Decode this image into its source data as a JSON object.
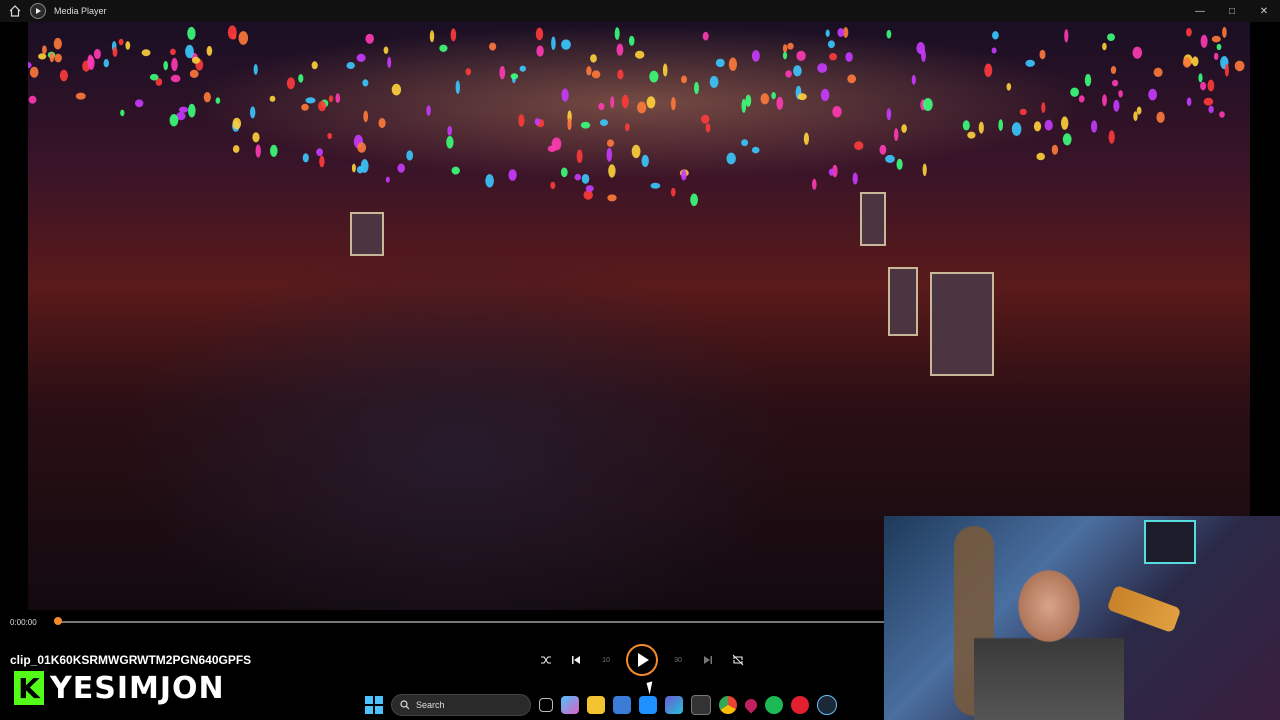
{
  "window": {
    "title": "Media Player",
    "home_icon": "home-icon",
    "app_icon": "media-player-icon",
    "minimize_icon": "minimize-icon",
    "maximize_icon": "maximize-icon",
    "close_icon": "close-icon"
  },
  "player": {
    "current_time": "0:00:00",
    "progress": 0.0,
    "clip_title": "clip_01K60KSRMWGRWTM2PGN640GPFS",
    "controls": {
      "shuffle_icon": "shuffle-icon",
      "previous_icon": "previous-icon",
      "rewind_label": "10",
      "play_icon": "play-icon",
      "forward_label": "30",
      "next_icon": "next-icon",
      "repeat_icon": "repeat-off-icon"
    }
  },
  "overlay": {
    "logo_letter": "K",
    "logo_text": "YESIMJON",
    "accent": "#53fc18"
  },
  "taskbar": {
    "search_placeholder": "Search",
    "start_icon": "windows-start-icon",
    "apps": [
      "task-view-icon",
      "copilot-icon",
      "file-explorer-icon",
      "store-icon",
      "mail-icon",
      "teams-icon",
      "keyboard-icon",
      "chrome-icon",
      "maps-icon",
      "spotify-icon",
      "opera-icon",
      "steam-icon"
    ]
  },
  "colors": {
    "accent_orange": "#f58a2a",
    "start_blue": "#4cc2ff"
  }
}
